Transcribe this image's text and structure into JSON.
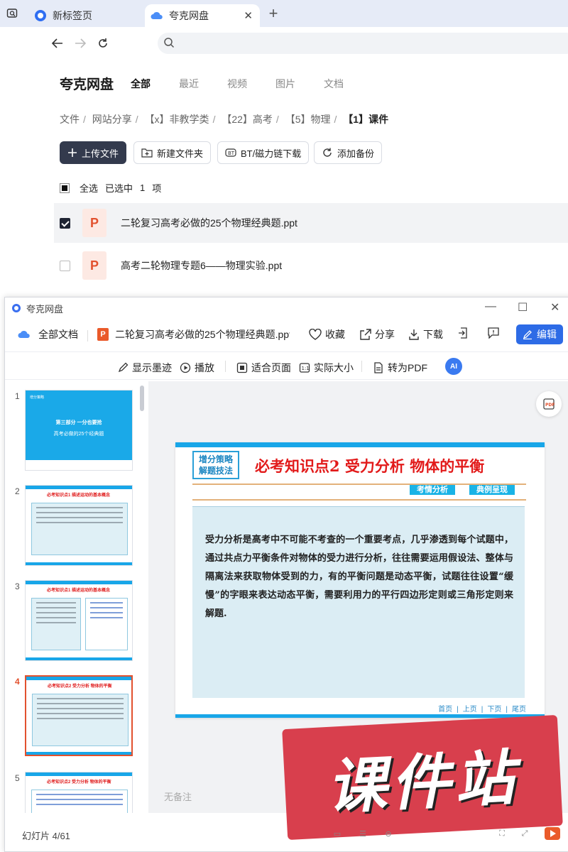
{
  "browser": {
    "tabs": [
      {
        "label": "新标签页"
      },
      {
        "label": "夸克网盘"
      }
    ]
  },
  "pan": {
    "brand": "夸克网盘",
    "nav_tabs": [
      "全部",
      "最近",
      "视频",
      "图片",
      "文档"
    ],
    "breadcrumb": [
      "文件",
      "网站分享",
      "【x】非教学类",
      "【22】高考",
      "【5】物理",
      "【1】课件"
    ],
    "actions": {
      "upload": "上传文件",
      "new_folder": "新建文件夹",
      "bt": "BT/磁力链下载",
      "backup": "添加备份"
    },
    "selection": {
      "select_all": "全选",
      "selected_prefix": "已选中",
      "count": "1",
      "unit": "项"
    },
    "files": [
      {
        "name": "二轮复习高考必做的25个物理经典题.ppt",
        "checked": true
      },
      {
        "name": "高考二轮物理专题6——物理实验.ppt",
        "checked": false
      }
    ]
  },
  "viewer": {
    "window_title": "夸克网盘",
    "all_docs": "全部文档",
    "file_name": "二轮复习高考必做的25个物理经典题.ppt",
    "favorite": "收藏",
    "share": "分享",
    "download": "下载",
    "edit": "编辑",
    "tools": {
      "ink": "显示墨迹",
      "play": "播放",
      "fit": "适合页面",
      "actual": "实际大小",
      "to_pdf": "转为PDF",
      "ai": "AI"
    },
    "thumbnails": [
      {
        "num": "1",
        "title": "第三部分  一分也要抢",
        "subtitle": "高考必做的25个经典题"
      },
      {
        "num": "2",
        "title": "必考知识点1  描述运动的基本概念"
      },
      {
        "num": "3",
        "title": "必考知识点1  描述运动的基本概念"
      },
      {
        "num": "4",
        "title": "必考知识点2  受力分析  物体的平衡"
      },
      {
        "num": "5",
        "title": "必考知识点2  受力分析  物体的平衡"
      }
    ],
    "slide": {
      "badge_line1": "增分策略",
      "badge_line2": "解题技法",
      "title": "必考知识点2   受力分析   物体的平衡",
      "tag1": "考情分析",
      "tag2": "典例呈现",
      "body": "受力分析是高考中不可能不考查的一个重要考点，几乎渗透到每个试题中，通过共点力平衡条件对物体的受力进行分析，往往需要运用假设法、整体与隔离法来获取物体受到的力，有的平衡问题是动态平衡，试题往往设置“缓慢”的字眼来表达动态平衡，需要利用力的平行四边形定则或三角形定则来解题.",
      "nav": [
        "首页",
        "上页",
        "下页",
        "尾页"
      ]
    },
    "notes_placeholder": "无备注",
    "watermark": "课件站",
    "status": "幻灯片 4/61"
  }
}
